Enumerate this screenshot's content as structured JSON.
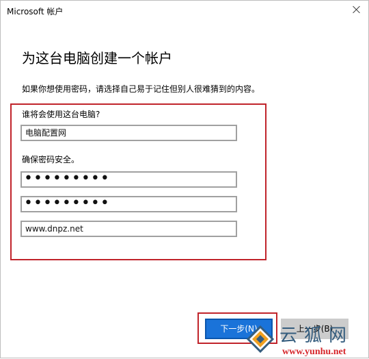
{
  "window": {
    "title": "Microsoft 帐户"
  },
  "page": {
    "heading": "为这台电脑创建一个帐户",
    "instruction": "如果你想使用密码，请选择自己易于记住但别人很难猜到的内容。"
  },
  "form": {
    "user_label": "谁将会使用这台电脑?",
    "username_value": "电脑配置网",
    "password_label": "确保密码安全。",
    "password_value": "•••••••••",
    "password_confirm_value": "•••••••••",
    "hint_value": "www.dnpz.net"
  },
  "buttons": {
    "next_label": "下一步(N)",
    "back_label": "上一步(B)"
  },
  "watermark": {
    "brand_cn": "云狐网",
    "url": "www.yunhu.net"
  },
  "colors": {
    "accent_blue": "#1a73d9",
    "highlight_red": "#c0232a"
  }
}
